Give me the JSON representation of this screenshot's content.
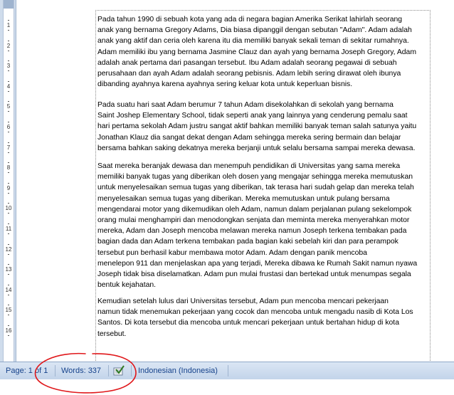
{
  "ruler": {
    "numbers": [
      "1",
      "2",
      "3",
      "4",
      "5",
      "6",
      "7",
      "8",
      "9",
      "10",
      "11",
      "12",
      "13",
      "14",
      "15",
      "16"
    ]
  },
  "document": {
    "paragraphs": [
      [
        " Pada tahun 1990 di sebuah kota yang ada di negara bagian Amerika Serikat lahirlah seorang",
        "anak yang bernama Gregory Adams, Dia biasa dipanggil dengan sebutan \"Adam\". Adam adalah",
        "anak yang aktif dan ceria oleh karena itu dia memiliki banyak sekali teman di sekitar rumahnya.",
        "Adam memiliki ibu yang bernama Jasmine Clauz dan ayah yang bernama Joseph Gregory, Adam",
        "adalah anak pertama dari pasangan tersebut. Ibu Adam adalah seorang pegawai di sebuah",
        "perusahaan dan ayah Adam adalah seorang pebisnis. Adam lebih sering dirawat oleh ibunya",
        "dibanding ayahnya karena ayahnya sering keluar kota untuk keperluan bisnis."
      ],
      [
        "    Pada suatu hari saat Adam berumur 7 tahun Adam disekolahkan di sekolah yang bernama",
        "Saint Joshep Elementary School, tidak seperti anak yang lainnya yang cenderung pemalu saat",
        "hari pertama sekolah Adam justru sangat aktif bahkan memiliki banyak teman salah satunya yaitu",
        "Jonathan Klauz dia sangat dekat dengan Adam sehingga mereka sering bermain dan belajar",
        "bersama bahkan saking dekatnya mereka berjanji untuk selalu bersama sampai mereka dewasa."
      ],
      [
        "    Saat mereka beranjak dewasa dan menempuh pendidikan di Universitas yang sama mereka",
        "memiliki banyak tugas yang diberikan oleh dosen yang mengajar sehingga mereka memutuskan",
        "untuk menyelesaikan semua tugas yang diberikan, tak terasa hari sudah gelap dan mereka telah",
        "menyelesaikan semua tugas yang diberikan. Mereka memutuskan untuk pulang bersama",
        "mengendarai motor yang dikemudikan oleh Adam, namun dalam perjalanan pulang sekelompok",
        "orang mulai menghampiri dan menodongkan senjata dan meminta mereka menyerahkan motor",
        "mereka, Adam dan Joseph mencoba melawan mereka namun Joseph terkena tembakan pada",
        "bagian dada dan Adam terkena tembakan pada bagian kaki sebelah kiri dan para perampok",
        "tersebut pun berhasil kabur membawa motor Adam. Adam dengan panik mencoba",
        "menelepon 911 dan menjelaskan apa yang terjadi, Mereka dibawa ke Rumah Sakit namun nyawa",
        "Joseph tidak bisa diselamatkan. Adam pun mulai frustasi dan bertekad untuk menumpas segala",
        "bentuk kejahatan."
      ],
      [
        "     Kemudian setelah lulus dari Universitas tersebut, Adam pun mencoba mencari pekerjaan",
        "namun tidak menemukan pekerjaan yang cocok dan mencoba untuk mengadu nasib di Kota Los",
        "Santos. Di kota tersebut dia mencoba untuk mencari pekerjaan untuk bertahan hidup di kota",
        "tersebut."
      ]
    ]
  },
  "statusbar": {
    "page": "Page: 1 of 1",
    "words": "Words: 337",
    "language": "Indonesian (Indonesia)",
    "proofing_icon": "proofing-check-icon"
  },
  "annotation": {
    "color": "#e0181b"
  }
}
